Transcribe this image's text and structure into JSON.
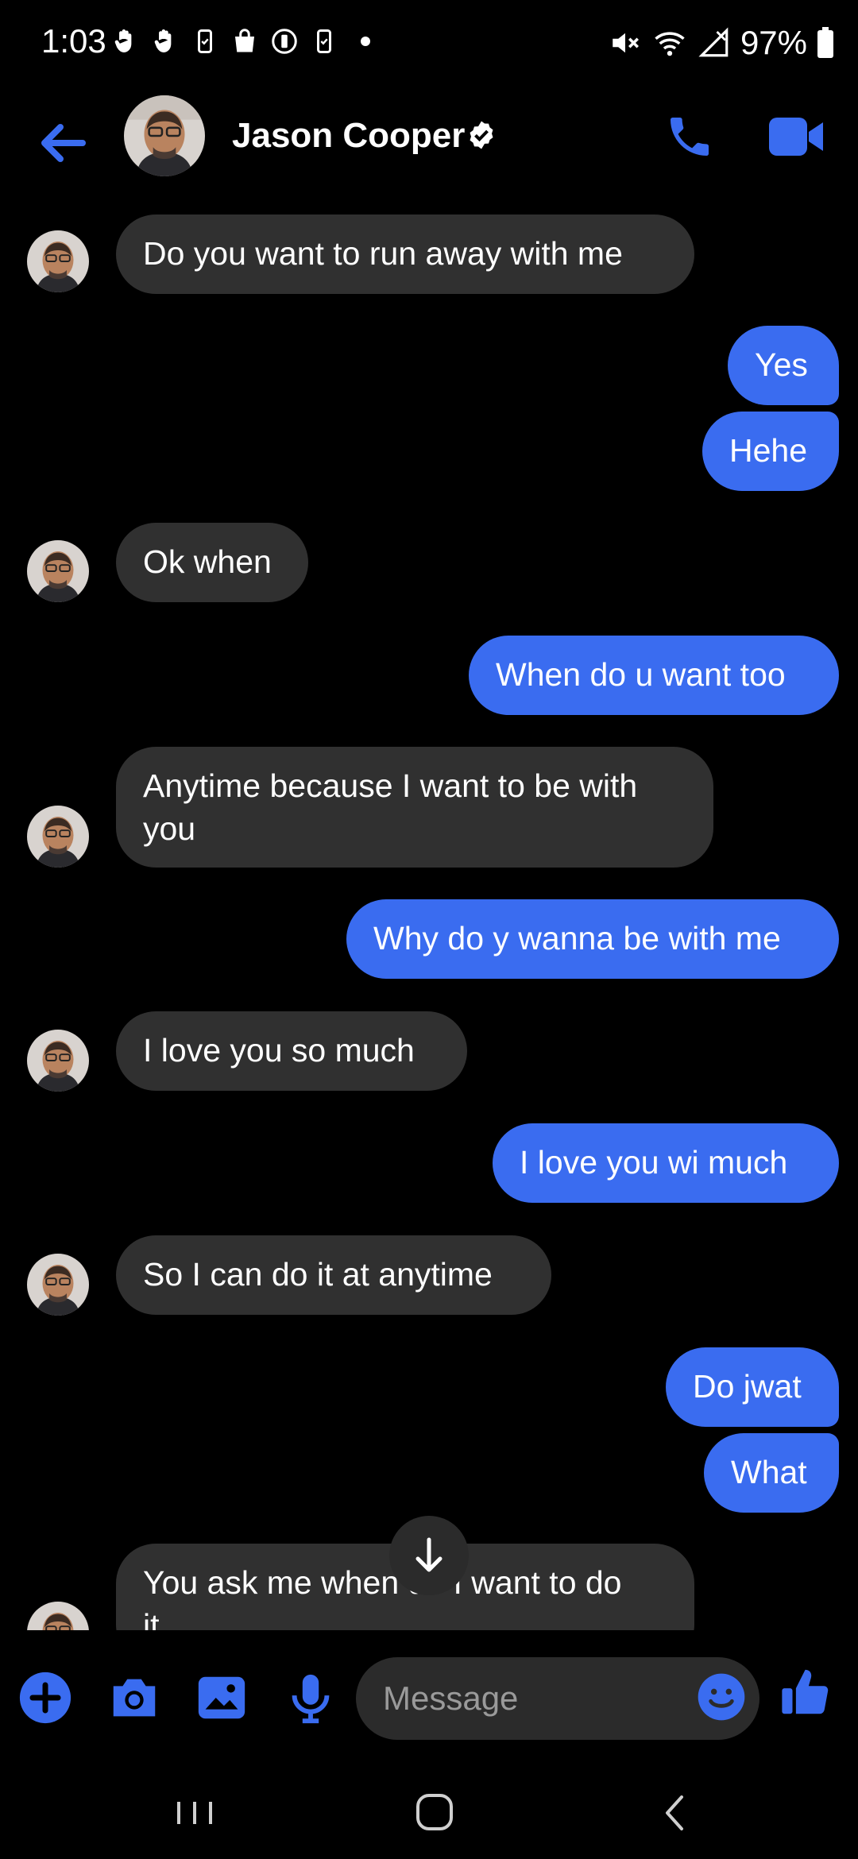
{
  "status_bar": {
    "time": "1:03",
    "battery": "97%"
  },
  "header": {
    "contact_name": "Jason Cooper"
  },
  "messages": [
    {
      "dir": "in",
      "text": "Do you want to run away with me"
    },
    {
      "dir": "out",
      "text": "Yes"
    },
    {
      "dir": "out",
      "text": "Hehe"
    },
    {
      "dir": "in",
      "text": "Ok when"
    },
    {
      "dir": "out",
      "text": "When do u want too"
    },
    {
      "dir": "in",
      "text": "Anytime because I want to be with\nyou"
    },
    {
      "dir": "out",
      "text": "Why do y wanna be with me"
    },
    {
      "dir": "in",
      "text": "I love you so much"
    },
    {
      "dir": "out",
      "text": "I love you wi much"
    },
    {
      "dir": "in",
      "text": "So I can do it at anytime"
    },
    {
      "dir": "out",
      "text": "Do jwat"
    },
    {
      "dir": "out",
      "text": "What"
    },
    {
      "dir": "in",
      "text": "You ask me when do I want to do\nit"
    }
  ],
  "composer": {
    "placeholder": "Message"
  },
  "colors": {
    "accent": "#3a6cf0",
    "incoming_bubble": "#303030",
    "background": "#000000"
  }
}
